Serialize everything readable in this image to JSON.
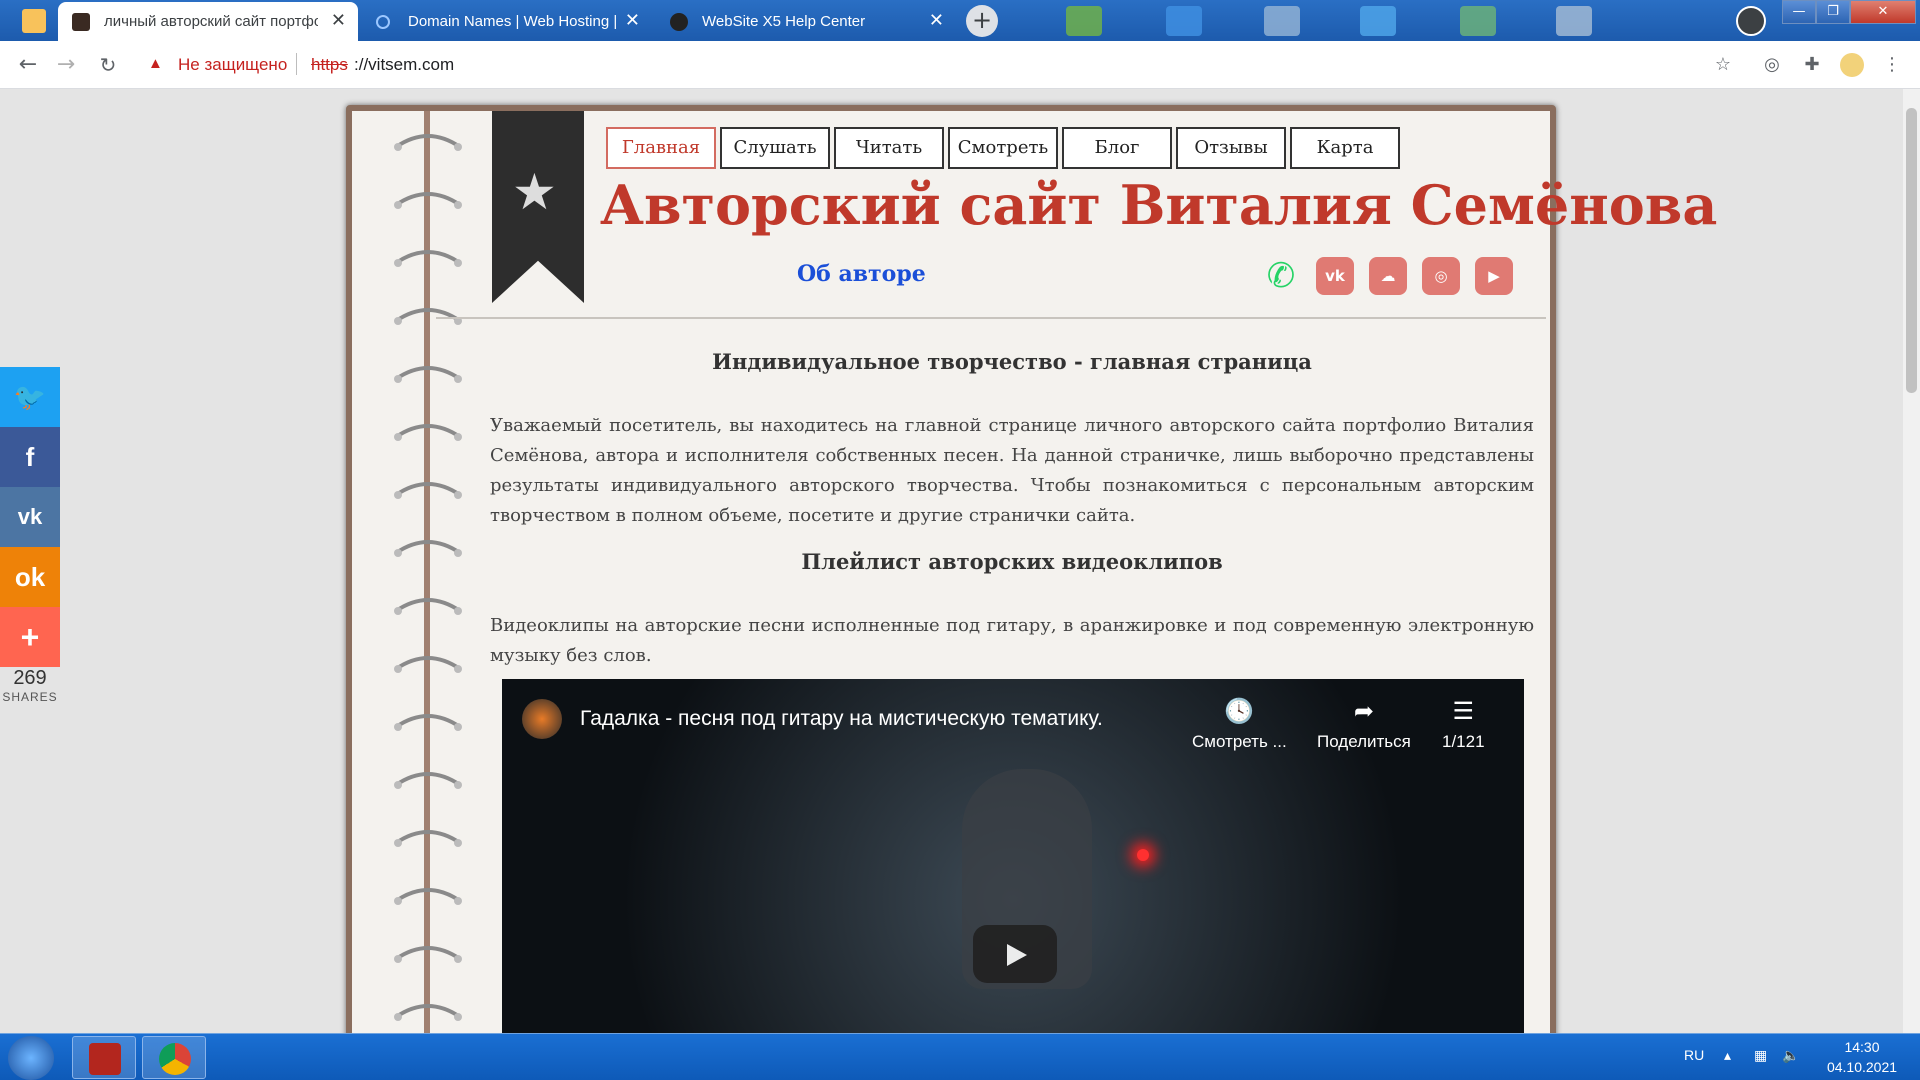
{
  "browser": {
    "tabs": [
      {
        "title": "личный авторский сайт портфо",
        "active": true
      },
      {
        "title": "Domain Names | Web Hosting | V",
        "active": false
      },
      {
        "title": "WebSite X5 Help Center",
        "active": false
      }
    ],
    "new_tab": "+",
    "window_controls": {
      "minimize": "—",
      "maximize": "❐",
      "close": "✕"
    },
    "address": {
      "security_label": "Не защищено",
      "protocol": "https",
      "rest": "://vitsem.com"
    }
  },
  "site": {
    "menu": [
      "Главная",
      "Слушать",
      "Читать",
      "Смотреть",
      "Блог",
      "Отзывы",
      "Карта"
    ],
    "active_menu": "Главная",
    "title": "Авторский сайт Виталия Семёнова",
    "about_link": "Об авторе",
    "social_icons": [
      "whatsapp-icon",
      "vk-icon",
      "soundcloud-icon",
      "instagram-icon",
      "youtube-icon"
    ],
    "heading1": "Индивидуальное творчество - главная страница",
    "para1": "Уважаемый посетитель, вы находитесь на главной странице личного авторского сайта портфолио Виталия Семёнова, автора и исполнителя собственных песен. На данной страничке, лишь выборочно представлены результаты индивидуального авторского творчества. Чтобы познакомиться с персональным авторским творчеством в полном объеме, посетите и другие странички сайта.",
    "heading2": "Плейлист авторских видеоклипов",
    "para2": "Видеоклипы на авторские песни исполненные под гитару, в аранжировке и под современную электронную музыку без слов.",
    "video": {
      "title": "Гадалка - песня под гитару на мистическую тематику.",
      "watch_later": "Смотреть ...",
      "share": "Поделиться",
      "playlist_pos": "1/121"
    }
  },
  "share_bar": {
    "buttons": [
      "twitter-icon",
      "facebook-icon",
      "vk-icon",
      "odnoklassniki-icon",
      "more-icon"
    ],
    "count": "269",
    "label": "SHARES"
  },
  "taskbar": {
    "lang": "RU",
    "time": "14:30",
    "date": "04.10.2021"
  },
  "colors": {
    "accent_red": "#c0392b",
    "link_blue": "#1b4fd8",
    "twitter": "#1da1f2",
    "facebook": "#3b5998",
    "vk": "#4c75a3",
    "ok": "#ee8208",
    "more": "#ff6550"
  }
}
